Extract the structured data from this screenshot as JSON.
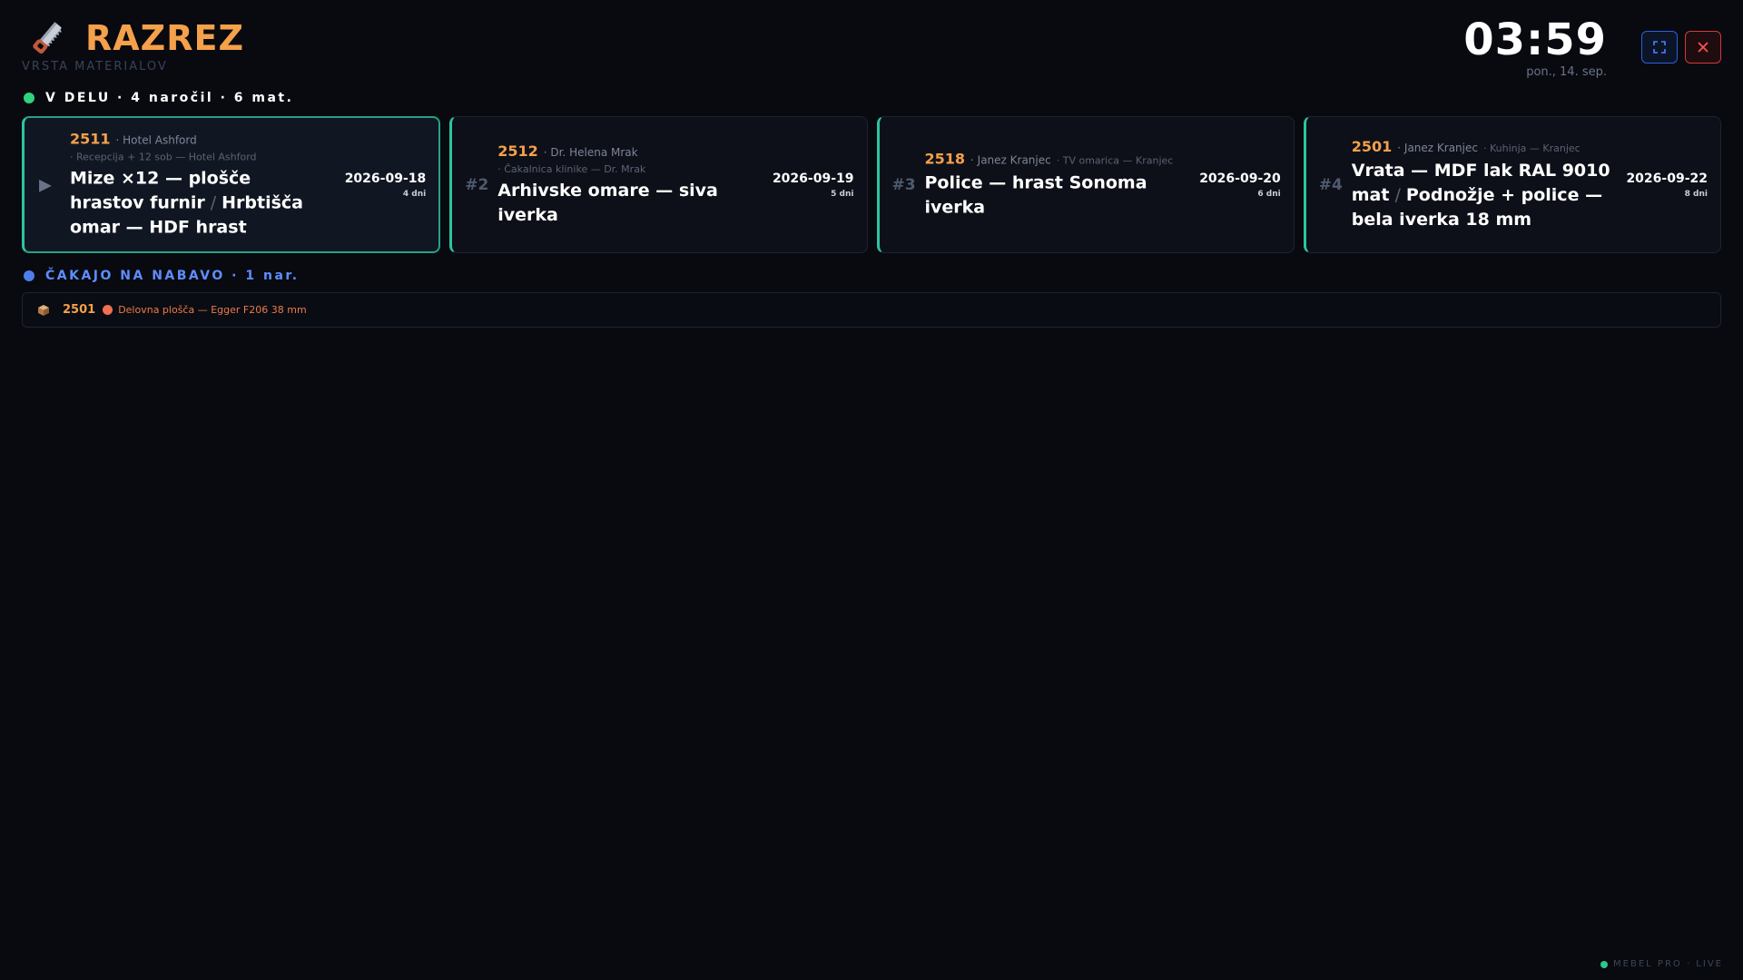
{
  "app": {
    "title": "RAZREZ",
    "subtitle": "VRSTA MATERIALOV"
  },
  "clock": {
    "time": "03:59",
    "date": "pon., 14. sep."
  },
  "sections": {
    "active": {
      "label": "V DELU · 4 naročil · 6 mat.",
      "color": "#2fd47a"
    },
    "waiting": {
      "label": "ČAKAJO NA NABAVO · 1 nar.",
      "color": "#4d7fe8"
    }
  },
  "orders": [
    {
      "marker": "▶",
      "number": "2511",
      "client": "· Hotel Ashford",
      "project": "· Recepcija + 12 sob — Hotel Ashford",
      "title_parts": [
        "Mize ×12 — plošče hrastov furnir",
        "Hrbtišča omar — HDF hrast"
      ],
      "date": "2026-09-18",
      "days": "4 dni"
    },
    {
      "marker": "#2",
      "number": "2512",
      "client": "· Dr. Helena Mrak",
      "project": "· Čakalnica klinike — Dr. Mrak",
      "title_parts": [
        "Arhivske omare — siva iverka"
      ],
      "date": "2026-09-19",
      "days": "5 dni"
    },
    {
      "marker": "#3",
      "number": "2518",
      "client": "· Janez Kranjec",
      "project": "· TV omarica — Kranjec",
      "title_parts": [
        "Police — hrast Sonoma iverka"
      ],
      "date": "2026-09-20",
      "days": "6 dni"
    },
    {
      "marker": "#4",
      "number": "2501",
      "client": "· Janez Kranjec",
      "project": "· Kuhinja — Kranjec",
      "title_parts": [
        "Vrata — MDF lak RAL 9010 mat",
        "Podnožje + police — bela iverka 18 mm"
      ],
      "date": "2026-09-22",
      "days": "8 dni"
    }
  ],
  "separator": "/",
  "waiting": {
    "order": "2501",
    "material": "Delovna plošča — Egger F206 38 mm"
  },
  "footer": {
    "status": "MEBEL PRO · LIVE"
  },
  "colors": {
    "accent": "#f5a04a",
    "card_border": "#2ec4a0",
    "close": "#d13b3b",
    "fullscreen": "#2c5fd6"
  }
}
